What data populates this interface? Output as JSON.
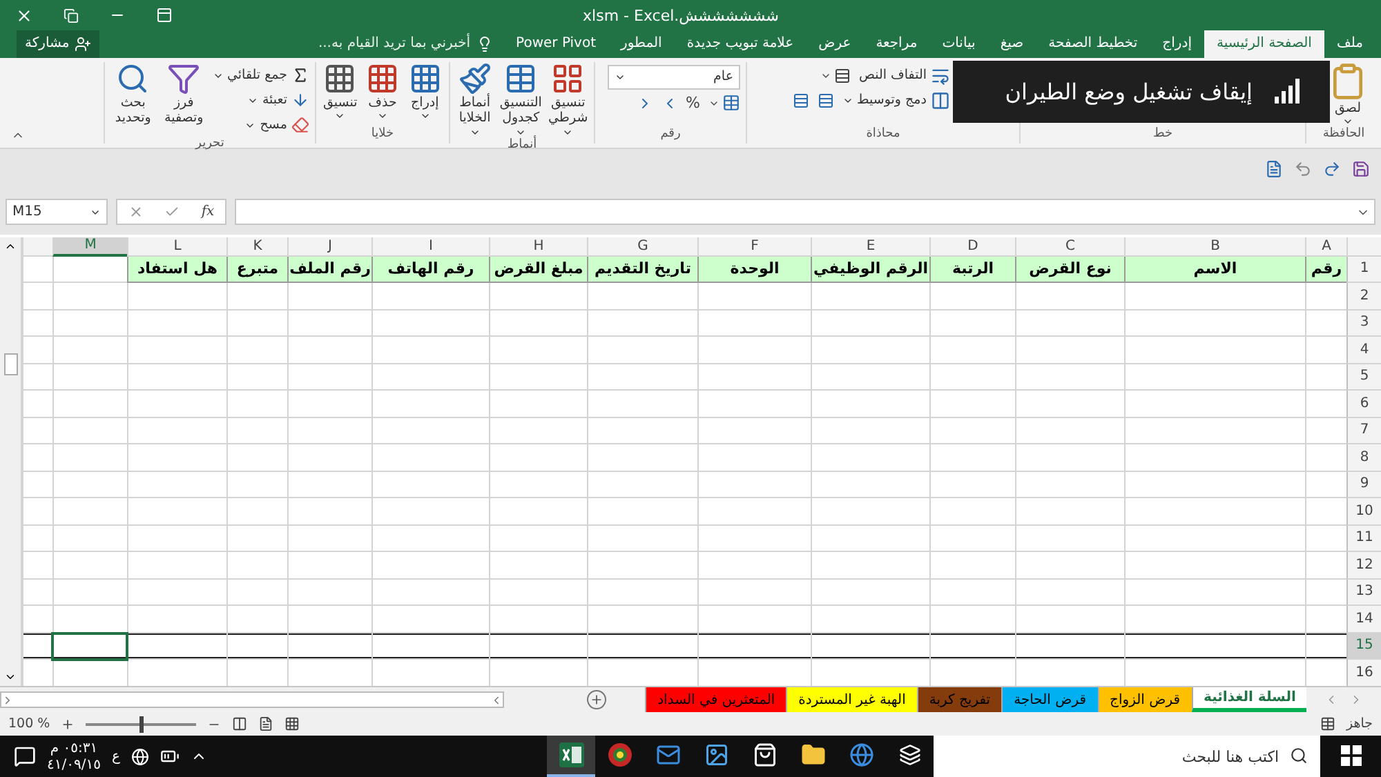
{
  "window": {
    "title": "ششششششش.xlsm - Excel"
  },
  "ribbon_tabs": [
    {
      "label": "ملف",
      "selected": false
    },
    {
      "label": "الصفحة الرئيسية",
      "selected": true
    },
    {
      "label": "إدراج",
      "selected": false
    },
    {
      "label": "تخطيط الصفحة",
      "selected": false
    },
    {
      "label": "صيغ",
      "selected": false
    },
    {
      "label": "بيانات",
      "selected": false
    },
    {
      "label": "مراجعة",
      "selected": false
    },
    {
      "label": "عرض",
      "selected": false
    },
    {
      "label": "علامة تبويب جديدة",
      "selected": false
    },
    {
      "label": "المطور",
      "selected": false
    },
    {
      "label": "Power Pivot",
      "selected": false
    }
  ],
  "tell_me": {
    "placeholder": "أخبرني بما تريد القيام به..."
  },
  "share_button": {
    "label": "مشاركة"
  },
  "ribbon_groups": [
    {
      "kind": "clipboard",
      "label": "الحافظة",
      "commands": [
        {
          "label": "لصق"
        }
      ]
    },
    {
      "kind": "font",
      "label": "خط"
    },
    {
      "kind": "alignment",
      "label": "محاذاة",
      "commands": [
        {
          "label": "التفاف النص"
        },
        {
          "label": "دمج وتوسيط"
        }
      ]
    },
    {
      "kind": "number",
      "label": "رقم",
      "format": "عام",
      "commands": [
        {
          "label": "%"
        }
      ]
    },
    {
      "kind": "styles",
      "label": "أنماط",
      "commands": [
        {
          "label": "تنسيق شرطي"
        },
        {
          "label": "التنسيق كجدول"
        },
        {
          "label": "أنماط الخلايا"
        }
      ]
    },
    {
      "kind": "cells",
      "label": "خلايا",
      "commands": [
        {
          "label": "إدراج"
        },
        {
          "label": "حذف"
        },
        {
          "label": "تنسيق"
        }
      ]
    },
    {
      "kind": "editing",
      "label": "تحرير",
      "commands": [
        {
          "label": "جمع تلقائي"
        },
        {
          "label": "تعبئة"
        },
        {
          "label": "مسح"
        },
        {
          "label": "فرز وتصفية"
        },
        {
          "label": "بحث وتحديد"
        }
      ]
    }
  ],
  "toast": {
    "text": "إيقاف تشغيل وضع الطيران"
  },
  "formula_bar": {
    "name_box": "M15",
    "function_label": "fx"
  },
  "columns": [
    {
      "letter": "A",
      "selected": false
    },
    {
      "letter": "B",
      "selected": false
    },
    {
      "letter": "C",
      "selected": false
    },
    {
      "letter": "D",
      "selected": false
    },
    {
      "letter": "E",
      "selected": false
    },
    {
      "letter": "F",
      "selected": false
    },
    {
      "letter": "G",
      "selected": false
    },
    {
      "letter": "H",
      "selected": false
    },
    {
      "letter": "I",
      "selected": false
    },
    {
      "letter": "J",
      "selected": false
    },
    {
      "letter": "K",
      "selected": false
    },
    {
      "letter": "L",
      "selected": false
    },
    {
      "letter": "M",
      "selected": true
    }
  ],
  "rows": [
    {
      "number": "1",
      "selected": false,
      "highlighted": true,
      "bordered": false,
      "cells": [
        "رقم",
        "الاسم",
        "نوع القرض",
        "الرتبة",
        "الرقم الوظيفي",
        "الوحدة",
        "تاريخ التقديم",
        "مبلغ القرض",
        "رقم الهاتف",
        "رقم الملف",
        "متبرع",
        "هل استفاد"
      ]
    },
    {
      "number": "2",
      "selected": false,
      "highlighted": false,
      "bordered": false
    },
    {
      "number": "3",
      "selected": false,
      "highlighted": false,
      "bordered": false
    },
    {
      "number": "4",
      "selected": false,
      "highlighted": false,
      "bordered": false
    },
    {
      "number": "5",
      "selected": false,
      "highlighted": false,
      "bordered": false
    },
    {
      "number": "6",
      "selected": false,
      "highlighted": false,
      "bordered": false
    },
    {
      "number": "7",
      "selected": false,
      "highlighted": false,
      "bordered": false
    },
    {
      "number": "8",
      "selected": false,
      "highlighted": false,
      "bordered": false
    },
    {
      "number": "9",
      "selected": false,
      "highlighted": false,
      "bordered": false
    },
    {
      "number": "10",
      "selected": false,
      "highlighted": false,
      "bordered": false
    },
    {
      "number": "11",
      "selected": false,
      "highlighted": false,
      "bordered": false
    },
    {
      "number": "12",
      "selected": false,
      "highlighted": false,
      "bordered": false
    },
    {
      "number": "13",
      "selected": false,
      "highlighted": false,
      "bordered": false
    },
    {
      "number": "14",
      "selected": false,
      "highlighted": false,
      "bordered": false
    },
    {
      "number": "15",
      "selected": true,
      "highlighted": false,
      "bordered": true
    },
    {
      "number": "16",
      "selected": false,
      "highlighted": false,
      "bordered": false
    }
  ],
  "sheet_tabs": [
    {
      "label": "السلة الغذائية",
      "color": "#00b050",
      "selected": true
    },
    {
      "label": "قرض الزواج",
      "color": "#ffc000",
      "selected": false
    },
    {
      "label": "قرض الحاجة",
      "color": "#00b0f0",
      "selected": false
    },
    {
      "label": "تفريج كربة",
      "color": "#843c0c",
      "selected": false
    },
    {
      "label": "الهبة غير المستردة",
      "color": "#ffff00",
      "selected": false
    },
    {
      "label": "المتعثرين في السداد",
      "color": "#ff0000",
      "selected": false
    }
  ],
  "status_bar": {
    "status": "جاهز",
    "zoom": "100 %",
    "zoom_level": {
      "level": 0.5
    }
  },
  "taskbar": {
    "search": {
      "placeholder": "اكتب هنا للبحث"
    },
    "apps": [
      {
        "kind": "taskview",
        "active": false
      },
      {
        "kind": "browser",
        "active": false
      },
      {
        "kind": "folder",
        "active": false
      },
      {
        "kind": "store",
        "active": false
      },
      {
        "kind": "photos",
        "active": false
      },
      {
        "kind": "mail",
        "active": false
      },
      {
        "kind": "badge",
        "active": false
      },
      {
        "kind": "spreadsheet",
        "active": true
      }
    ],
    "language": "ع",
    "time": "٠٥:٣١ م",
    "date": "٤١/٠٩/١٥"
  }
}
